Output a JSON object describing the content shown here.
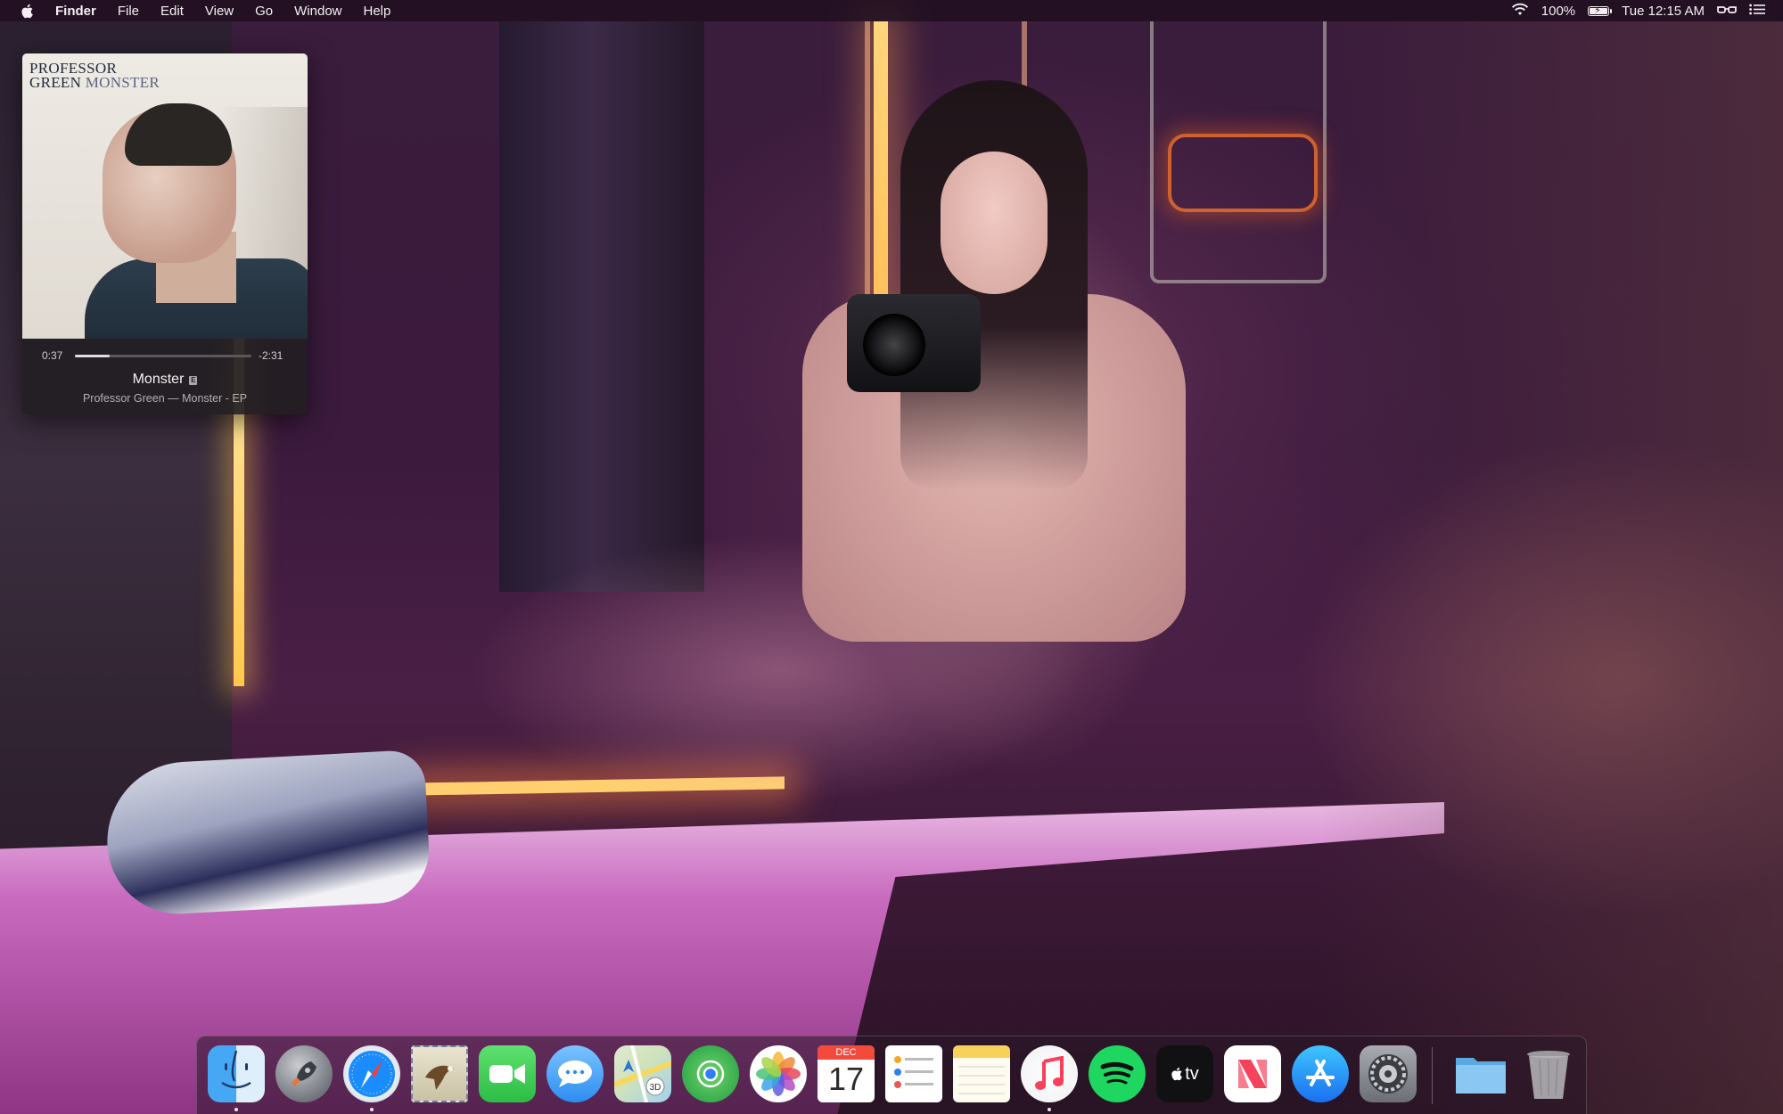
{
  "menubar": {
    "apple_icon": "apple-logo-icon",
    "app_name": "Finder",
    "menus": [
      "File",
      "Edit",
      "View",
      "Go",
      "Window",
      "Help"
    ],
    "status": {
      "wifi_icon": "wifi-icon",
      "battery_percent": "100%",
      "battery_level": 1.0,
      "battery_icon": "battery-charging-icon",
      "clock": "Tue 12:15 AM",
      "accessibility_icon": "glasses-icon",
      "list_icon": "notification-center-icon"
    }
  },
  "music_widget": {
    "album_line1": "PROFESSOR",
    "album_line2_bold": "GREEN",
    "album_line2_light": "MONSTER",
    "time_elapsed": "0:37",
    "time_remaining": "-2:31",
    "progress_fraction": 0.197,
    "track_title": "Monster",
    "explicit_badge": "E",
    "track_subtitle": "Professor Green — Monster - EP"
  },
  "dock": {
    "items": [
      {
        "name": "Finder",
        "icon": "finder-icon",
        "running": true
      },
      {
        "name": "Launchpad",
        "icon": "launchpad-icon",
        "running": false
      },
      {
        "name": "Safari",
        "icon": "safari-icon",
        "running": true
      },
      {
        "name": "Mail",
        "icon": "mail-icon",
        "running": false
      },
      {
        "name": "FaceTime",
        "icon": "facetime-icon",
        "running": false
      },
      {
        "name": "Messages",
        "icon": "messages-icon",
        "running": false
      },
      {
        "name": "Maps",
        "icon": "maps-icon",
        "running": false
      },
      {
        "name": "Find My",
        "icon": "findmy-icon",
        "running": false
      },
      {
        "name": "Photos",
        "icon": "photos-icon",
        "running": false
      },
      {
        "name": "Calendar",
        "icon": "calendar-icon",
        "running": false
      },
      {
        "name": "Reminders",
        "icon": "reminders-icon",
        "running": false
      },
      {
        "name": "Notes",
        "icon": "notes-icon",
        "running": false
      },
      {
        "name": "Music",
        "icon": "music-icon",
        "running": true
      },
      {
        "name": "Spotify",
        "icon": "spotify-icon",
        "running": false
      },
      {
        "name": "TV",
        "icon": "appletv-icon",
        "running": false
      },
      {
        "name": "News",
        "icon": "news-icon",
        "running": false
      },
      {
        "name": "App Store",
        "icon": "appstore-icon",
        "running": false
      },
      {
        "name": "System Preferences",
        "icon": "system-preferences-icon",
        "running": false
      },
      {
        "name": "Downloads",
        "icon": "folder-icon",
        "running": false
      },
      {
        "name": "Trash",
        "icon": "trash-icon",
        "running": false
      }
    ],
    "calendar_month": "DEC",
    "calendar_day": "17",
    "tv_label": "tv"
  },
  "colors": {
    "spotify_green": "#1ed760",
    "safari_blue": "#1a8cff",
    "appstore_blue": "#1a9bff"
  }
}
